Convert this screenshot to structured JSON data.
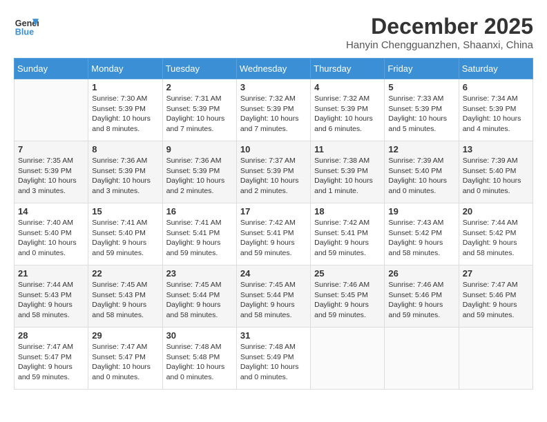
{
  "header": {
    "logo_line1": "General",
    "logo_line2": "Blue",
    "month": "December 2025",
    "location": "Hanyin Chengguanzhen, Shaanxi, China"
  },
  "days_of_week": [
    "Sunday",
    "Monday",
    "Tuesday",
    "Wednesday",
    "Thursday",
    "Friday",
    "Saturday"
  ],
  "weeks": [
    [
      {
        "day": "",
        "sunrise": "",
        "sunset": "",
        "daylight": ""
      },
      {
        "day": "1",
        "sunrise": "Sunrise: 7:30 AM",
        "sunset": "Sunset: 5:39 PM",
        "daylight": "Daylight: 10 hours and 8 minutes."
      },
      {
        "day": "2",
        "sunrise": "Sunrise: 7:31 AM",
        "sunset": "Sunset: 5:39 PM",
        "daylight": "Daylight: 10 hours and 7 minutes."
      },
      {
        "day": "3",
        "sunrise": "Sunrise: 7:32 AM",
        "sunset": "Sunset: 5:39 PM",
        "daylight": "Daylight: 10 hours and 7 minutes."
      },
      {
        "day": "4",
        "sunrise": "Sunrise: 7:32 AM",
        "sunset": "Sunset: 5:39 PM",
        "daylight": "Daylight: 10 hours and 6 minutes."
      },
      {
        "day": "5",
        "sunrise": "Sunrise: 7:33 AM",
        "sunset": "Sunset: 5:39 PM",
        "daylight": "Daylight: 10 hours and 5 minutes."
      },
      {
        "day": "6",
        "sunrise": "Sunrise: 7:34 AM",
        "sunset": "Sunset: 5:39 PM",
        "daylight": "Daylight: 10 hours and 4 minutes."
      }
    ],
    [
      {
        "day": "7",
        "sunrise": "Sunrise: 7:35 AM",
        "sunset": "Sunset: 5:39 PM",
        "daylight": "Daylight: 10 hours and 3 minutes."
      },
      {
        "day": "8",
        "sunrise": "Sunrise: 7:36 AM",
        "sunset": "Sunset: 5:39 PM",
        "daylight": "Daylight: 10 hours and 3 minutes."
      },
      {
        "day": "9",
        "sunrise": "Sunrise: 7:36 AM",
        "sunset": "Sunset: 5:39 PM",
        "daylight": "Daylight: 10 hours and 2 minutes."
      },
      {
        "day": "10",
        "sunrise": "Sunrise: 7:37 AM",
        "sunset": "Sunset: 5:39 PM",
        "daylight": "Daylight: 10 hours and 2 minutes."
      },
      {
        "day": "11",
        "sunrise": "Sunrise: 7:38 AM",
        "sunset": "Sunset: 5:39 PM",
        "daylight": "Daylight: 10 hours and 1 minute."
      },
      {
        "day": "12",
        "sunrise": "Sunrise: 7:39 AM",
        "sunset": "Sunset: 5:40 PM",
        "daylight": "Daylight: 10 hours and 0 minutes."
      },
      {
        "day": "13",
        "sunrise": "Sunrise: 7:39 AM",
        "sunset": "Sunset: 5:40 PM",
        "daylight": "Daylight: 10 hours and 0 minutes."
      }
    ],
    [
      {
        "day": "14",
        "sunrise": "Sunrise: 7:40 AM",
        "sunset": "Sunset: 5:40 PM",
        "daylight": "Daylight: 10 hours and 0 minutes."
      },
      {
        "day": "15",
        "sunrise": "Sunrise: 7:41 AM",
        "sunset": "Sunset: 5:40 PM",
        "daylight": "Daylight: 9 hours and 59 minutes."
      },
      {
        "day": "16",
        "sunrise": "Sunrise: 7:41 AM",
        "sunset": "Sunset: 5:41 PM",
        "daylight": "Daylight: 9 hours and 59 minutes."
      },
      {
        "day": "17",
        "sunrise": "Sunrise: 7:42 AM",
        "sunset": "Sunset: 5:41 PM",
        "daylight": "Daylight: 9 hours and 59 minutes."
      },
      {
        "day": "18",
        "sunrise": "Sunrise: 7:42 AM",
        "sunset": "Sunset: 5:41 PM",
        "daylight": "Daylight: 9 hours and 59 minutes."
      },
      {
        "day": "19",
        "sunrise": "Sunrise: 7:43 AM",
        "sunset": "Sunset: 5:42 PM",
        "daylight": "Daylight: 9 hours and 58 minutes."
      },
      {
        "day": "20",
        "sunrise": "Sunrise: 7:44 AM",
        "sunset": "Sunset: 5:42 PM",
        "daylight": "Daylight: 9 hours and 58 minutes."
      }
    ],
    [
      {
        "day": "21",
        "sunrise": "Sunrise: 7:44 AM",
        "sunset": "Sunset: 5:43 PM",
        "daylight": "Daylight: 9 hours and 58 minutes."
      },
      {
        "day": "22",
        "sunrise": "Sunrise: 7:45 AM",
        "sunset": "Sunset: 5:43 PM",
        "daylight": "Daylight: 9 hours and 58 minutes."
      },
      {
        "day": "23",
        "sunrise": "Sunrise: 7:45 AM",
        "sunset": "Sunset: 5:44 PM",
        "daylight": "Daylight: 9 hours and 58 minutes."
      },
      {
        "day": "24",
        "sunrise": "Sunrise: 7:45 AM",
        "sunset": "Sunset: 5:44 PM",
        "daylight": "Daylight: 9 hours and 58 minutes."
      },
      {
        "day": "25",
        "sunrise": "Sunrise: 7:46 AM",
        "sunset": "Sunset: 5:45 PM",
        "daylight": "Daylight: 9 hours and 59 minutes."
      },
      {
        "day": "26",
        "sunrise": "Sunrise: 7:46 AM",
        "sunset": "Sunset: 5:46 PM",
        "daylight": "Daylight: 9 hours and 59 minutes."
      },
      {
        "day": "27",
        "sunrise": "Sunrise: 7:47 AM",
        "sunset": "Sunset: 5:46 PM",
        "daylight": "Daylight: 9 hours and 59 minutes."
      }
    ],
    [
      {
        "day": "28",
        "sunrise": "Sunrise: 7:47 AM",
        "sunset": "Sunset: 5:47 PM",
        "daylight": "Daylight: 9 hours and 59 minutes."
      },
      {
        "day": "29",
        "sunrise": "Sunrise: 7:47 AM",
        "sunset": "Sunset: 5:47 PM",
        "daylight": "Daylight: 10 hours and 0 minutes."
      },
      {
        "day": "30",
        "sunrise": "Sunrise: 7:48 AM",
        "sunset": "Sunset: 5:48 PM",
        "daylight": "Daylight: 10 hours and 0 minutes."
      },
      {
        "day": "31",
        "sunrise": "Sunrise: 7:48 AM",
        "sunset": "Sunset: 5:49 PM",
        "daylight": "Daylight: 10 hours and 0 minutes."
      },
      {
        "day": "",
        "sunrise": "",
        "sunset": "",
        "daylight": ""
      },
      {
        "day": "",
        "sunrise": "",
        "sunset": "",
        "daylight": ""
      },
      {
        "day": "",
        "sunrise": "",
        "sunset": "",
        "daylight": ""
      }
    ]
  ]
}
